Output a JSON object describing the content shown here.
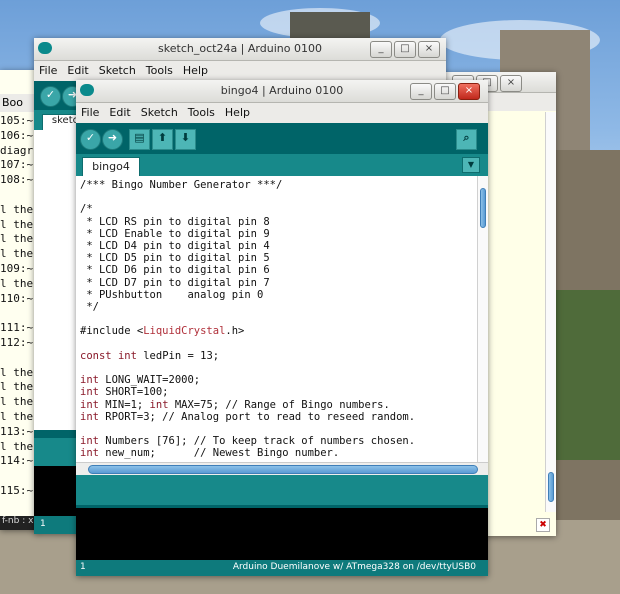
{
  "desktop": {
    "left_terminal": {
      "menu_fragment": "Boo",
      "lines": [
        "105:~",
        "106:~",
        "diagr",
        "107:~",
        "108:~",
        "",
        "l the",
        "l the",
        "l the",
        "l the",
        "109:~",
        "l the",
        "110:~",
        "",
        "111:~",
        "112:~",
        "",
        "l the",
        "l the",
        "l the",
        "l the",
        "113:~",
        "l the",
        "114:~",
        "",
        "115:~"
      ],
      "status": "f-nb : x"
    }
  },
  "window_back": {
    "title": "sketch_oct24a | Arduino 0100",
    "menu": [
      "File",
      "Edit",
      "Sketch",
      "Tools",
      "Help"
    ],
    "tab_label": "sketc",
    "status_line": "1"
  },
  "window_right": {
    "close_glyph": "✖"
  },
  "window_main": {
    "title": "bingo4 | Arduino 0100",
    "menu": [
      "File",
      "Edit",
      "Sketch",
      "Tools",
      "Help"
    ],
    "toolbar": {
      "verify_icon": "✓",
      "upload_icon": "➜",
      "new_icon": "▤",
      "open_icon": "⬆",
      "save_icon": "⬇",
      "serial_icon": "⌕"
    },
    "tab_label": "bingo4",
    "tab_menu_icon": "▼",
    "code_lines": [
      "/*** Bingo Number Generator ***/",
      "",
      "/*",
      " * LCD RS pin to digital pin 8",
      " * LCD Enable to digital pin 9",
      " * LCD D4 pin to digital pin 4",
      " * LCD D5 pin to digital pin 5",
      " * LCD D6 pin to digital pin 6",
      " * LCD D7 pin to digital pin 7",
      " * PUshbutton    analog pin 0",
      " */",
      "",
      "#include <LiquidCrystal.h>",
      "",
      "const int ledPin = 13;",
      "",
      "int LONG_WAIT=2000;",
      "int SHORT=100;",
      "int MIN=1; int MAX=75; // Range of Bingo numbers.",
      "int RPORT=3; // Analog port to read to reseed random.",
      "",
      "int Numbers [76]; // To keep track of numbers chosen.",
      "int new_num;      // Newest Bingo number."
    ],
    "status_line": "1",
    "board_info": "Arduino Duemilanove w/ ATmega328 on /dev/ttyUSB0"
  }
}
